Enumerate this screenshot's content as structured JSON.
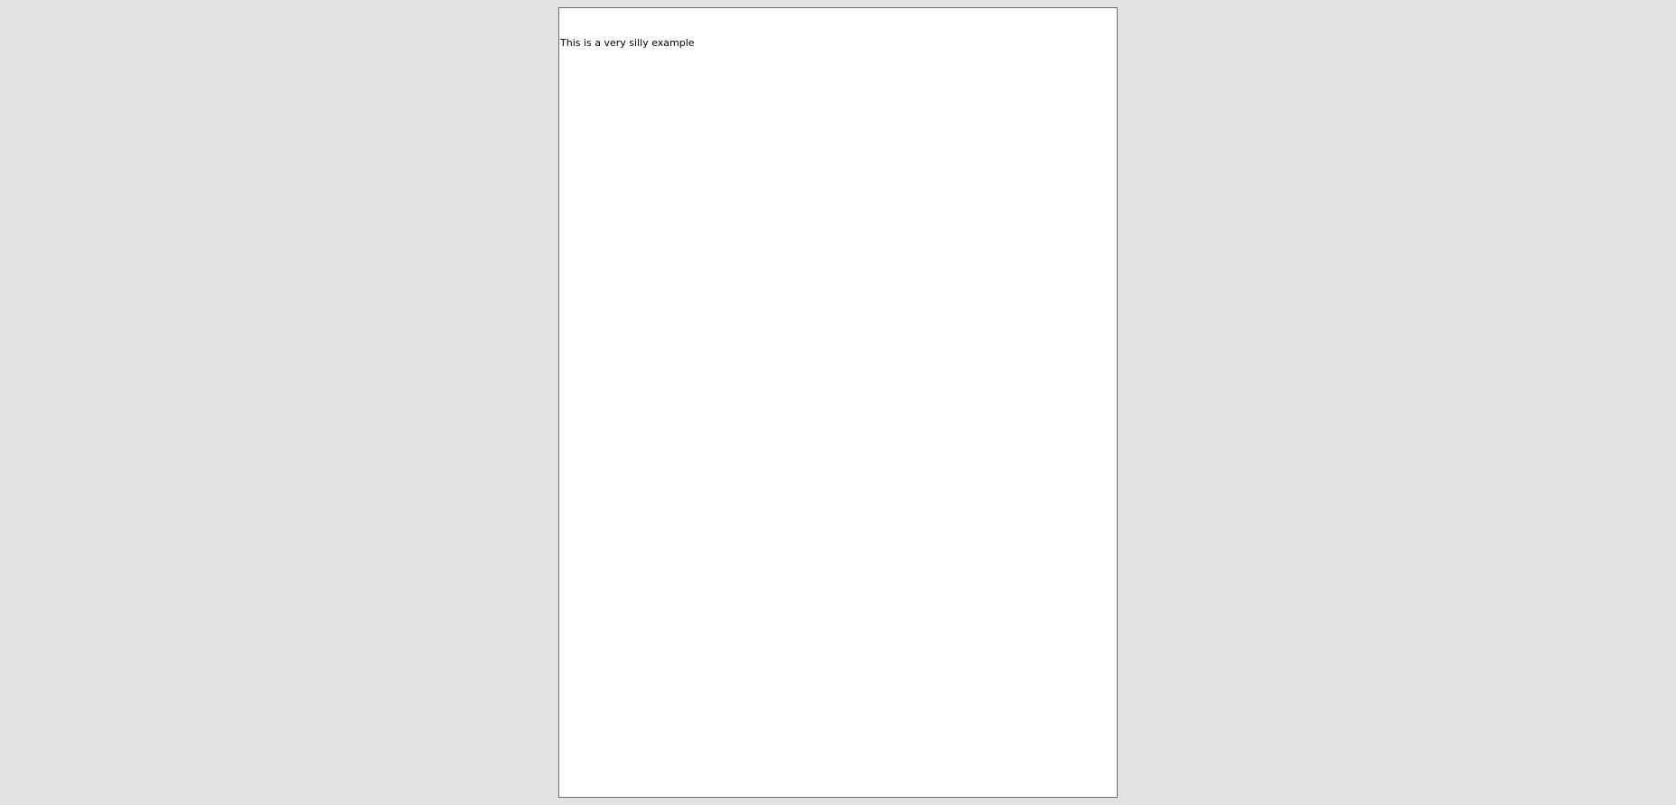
{
  "document": {
    "page": {
      "text": "This is a very silly example"
    }
  },
  "colors": {
    "background": "#e2e2e2",
    "page": "#ffffff",
    "page_border": "#6e6e6e",
    "text": "#000000"
  }
}
